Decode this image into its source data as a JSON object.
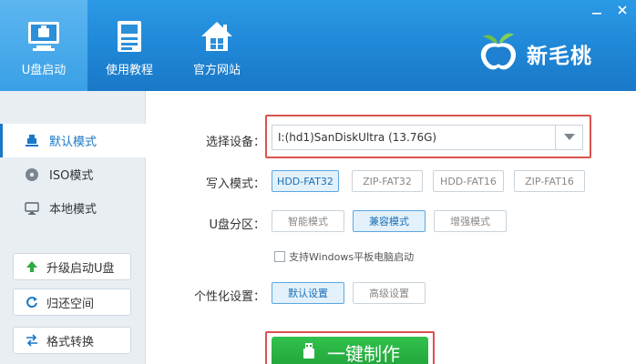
{
  "header": {
    "nav": [
      {
        "label": "U盘启动",
        "icon": "usb-monitor-icon"
      },
      {
        "label": "使用教程",
        "icon": "document-icon"
      },
      {
        "label": "官方网站",
        "icon": "home-icon"
      }
    ],
    "brand": {
      "name": "新毛桃",
      "icon": "peach-logo-icon"
    },
    "window_controls": [
      "minimize-icon",
      "close-icon"
    ]
  },
  "sidebar": {
    "modes": [
      {
        "label": "默认模式",
        "icon": "usb-drive-icon",
        "active": true
      },
      {
        "label": "ISO模式",
        "icon": "disc-icon",
        "active": false
      },
      {
        "label": "本地模式",
        "icon": "monitor-icon",
        "active": false
      }
    ],
    "tools": [
      {
        "label": "升级启动U盘",
        "icon": "arrow-up-icon"
      },
      {
        "label": "归还空间",
        "icon": "restore-icon"
      },
      {
        "label": "格式转换",
        "icon": "convert-icon"
      }
    ]
  },
  "main": {
    "device": {
      "label": "选择设备：",
      "value": "I:(hd1)SanDiskUltra (13.76G)"
    },
    "write_mode": {
      "label": "写入模式：",
      "options": [
        "HDD-FAT32",
        "ZIP-FAT32",
        "HDD-FAT16",
        "ZIP-FAT16"
      ],
      "selected": "HDD-FAT32"
    },
    "partition": {
      "label": "U盘分区：",
      "options": [
        "智能模式",
        "兼容模式",
        "增强模式"
      ],
      "selected": "兼容模式"
    },
    "tablet_support": {
      "label": "支持Windows平板电脑启动",
      "checked": false
    },
    "personalize": {
      "label": "个性化设置：",
      "options": [
        "默认设置",
        "高级设置"
      ],
      "selected": "默认设置"
    },
    "action": {
      "label": "一键制作",
      "icon": "usb-plug-icon"
    }
  },
  "colors": {
    "header_blue": "#1f86d6",
    "accent_blue": "#1a78c7",
    "highlight_red": "#d9534f",
    "action_green": "#21a43a"
  }
}
